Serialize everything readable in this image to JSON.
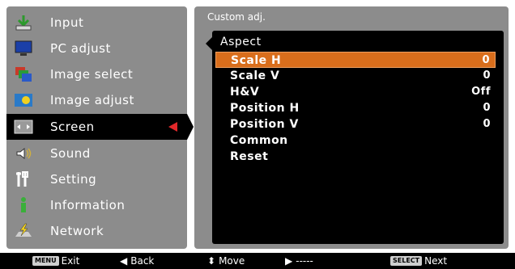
{
  "menu": {
    "items": [
      {
        "label": "Input",
        "icon": "input-icon"
      },
      {
        "label": "PC adjust",
        "icon": "pc-adjust-icon"
      },
      {
        "label": "Image select",
        "icon": "image-select-icon"
      },
      {
        "label": "Image adjust",
        "icon": "image-adjust-icon"
      },
      {
        "label": "Screen",
        "icon": "screen-icon",
        "selected": true
      },
      {
        "label": "Sound",
        "icon": "sound-icon"
      },
      {
        "label": "Setting",
        "icon": "setting-icon"
      },
      {
        "label": "Information",
        "icon": "information-icon"
      },
      {
        "label": "Network",
        "icon": "network-icon"
      }
    ]
  },
  "panel": {
    "title": "Custom adj.",
    "subtitle": "Aspect",
    "rows": [
      {
        "label": "Scale H",
        "value": "0",
        "selected": true
      },
      {
        "label": "Scale V",
        "value": "0"
      },
      {
        "label": "H&V",
        "value": "Off"
      },
      {
        "label": "Position H",
        "value": "0"
      },
      {
        "label": "Position V",
        "value": "0"
      },
      {
        "label": "Common",
        "value": ""
      },
      {
        "label": "Reset",
        "value": ""
      }
    ]
  },
  "footer": {
    "exit_key": "MENU",
    "exit_label": "Exit",
    "back_glyph": "◀",
    "back_label": "Back",
    "move_glyph": "⬍",
    "move_label": "Move",
    "next_glyph": "▶",
    "next_placeholder": "-----",
    "select_key": "SELECT",
    "select_label": "Next"
  },
  "colors": {
    "panel_bg": "#8c8c8c",
    "selected_row": "#d96e1c",
    "arrow_red": "#e0282a"
  }
}
